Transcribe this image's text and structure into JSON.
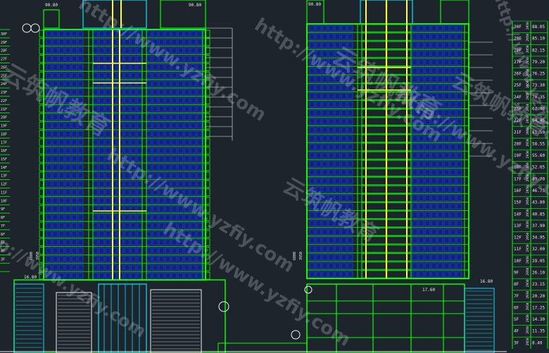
{
  "drawing": {
    "left_elevation": {
      "levels": [
        "3F",
        "4F",
        "5F",
        "6F",
        "7F",
        "8F",
        "9F",
        "10F",
        "11F",
        "12F",
        "13F",
        "14F",
        "15F",
        "16F",
        "17F",
        "18F",
        "19F",
        "20F",
        "21F",
        "22F",
        "23F",
        "24F",
        "25F",
        "26F",
        "27F",
        "28F",
        "29F",
        "30F"
      ],
      "labels": {
        "top_left": "90.80",
        "roof_right": "90.80",
        "podium_left": "16.80",
        "small_left": "2.70"
      },
      "floor_count": 30
    },
    "right_elevation": {
      "levels": [
        "3F",
        "4F",
        "5F",
        "6F",
        "7F",
        "8F",
        "9F",
        "10F",
        "11F",
        "12F",
        "13F",
        "14F",
        "15F",
        "16F",
        "17F",
        "18F",
        "19F",
        "20F",
        "21F",
        "22F",
        "23F",
        "24F",
        "25F",
        "26F",
        "27F",
        "28F",
        "29F",
        "30F"
      ],
      "labels": {
        "top_left": "90.80",
        "podium_mid": "17.60",
        "podium_right": "16.80"
      },
      "heights": [
        "88.05",
        "85.10",
        "82.15",
        "79.20",
        "76.25",
        "73.30",
        "70.35",
        "67.40",
        "64.45",
        "61.50",
        "58.55",
        "55.60",
        "52.65",
        "49.70",
        "46.75",
        "43.80",
        "40.85",
        "37.90",
        "34.95",
        "32.00",
        "29.05",
        "26.10",
        "23.15",
        "20.20",
        "17.25",
        "14.30",
        "11.35",
        "8.40"
      ],
      "floor_height": "2950"
    },
    "grid_marks": {
      "left_top_a": "A",
      "left_top_b": "B"
    }
  },
  "watermarks": [
    "http://www.yzfiy.com",
    "云筑帆教育"
  ],
  "colors": {
    "background": "#1e242c",
    "outline_green": "#00ff00",
    "window_blue": "#1a3aff",
    "axis_yellow": "#ffff33",
    "cyan": "#00e5ff",
    "white": "#f2f2f2"
  }
}
